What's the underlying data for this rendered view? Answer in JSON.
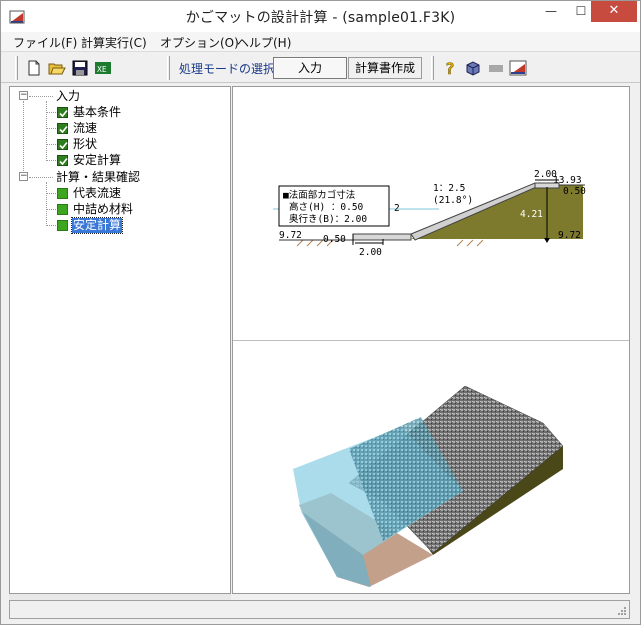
{
  "window": {
    "title": "かごマットの設計計算 - (sample01.F3K)",
    "minimize_glyph": "—",
    "maximize_glyph": "☐",
    "close_glyph": "✕"
  },
  "menu": {
    "items": [
      "ファイル(F)",
      "計算実行(C)",
      "オプション(O)",
      "ヘルプ(H)"
    ]
  },
  "toolbar": {
    "mode_label": "処理モードの選択",
    "mode_value": "入力",
    "report_button": "計算書作成"
  },
  "tree": {
    "input_group": "入力",
    "input_items": [
      "基本条件",
      "流速",
      "形状",
      "安定計算"
    ],
    "result_group": "計算・結果確認",
    "result_items": [
      "代表流速",
      "中詰め材料",
      "安定計算"
    ]
  },
  "section": {
    "legend_title": "■法面部カゴ寸法",
    "legend_height": "高さ(H)  ：0.50",
    "legend_depth": "奥行き(B)：2.00",
    "slope_ratio": "1：2.5",
    "slope_angle": "(21.8°)",
    "top_width": "2.00",
    "right_level": "13.93",
    "right_thick": "0.50",
    "height_value": "4.21",
    "right_bottom_level": "9.72",
    "left_level": "9.72",
    "bottom_thick": "0.50",
    "bottom_width": "2.00",
    "water_mark": "2"
  },
  "colors": {
    "accent_blue": "#3a78d8",
    "check_green": "#2e7d1e",
    "embankment": "#7d7a2e",
    "water": "#7fc4d8",
    "gabion": "#8a8a8a"
  }
}
